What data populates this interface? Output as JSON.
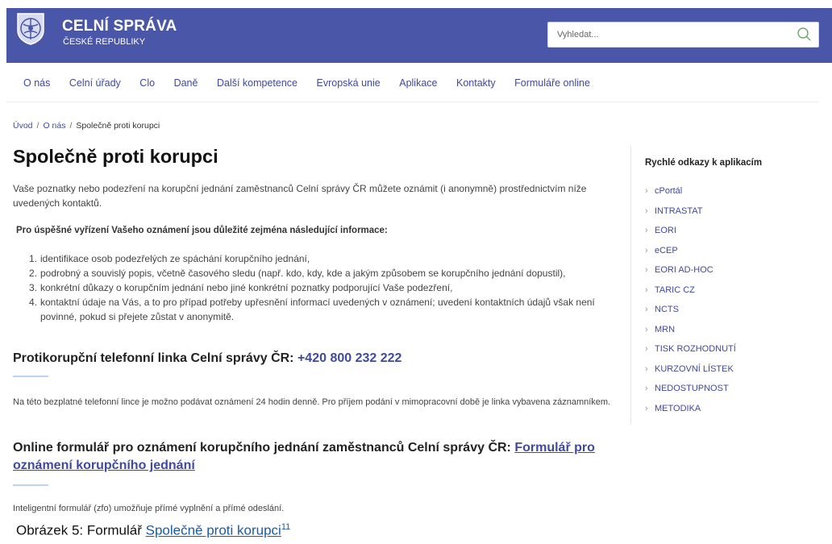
{
  "header": {
    "brand_title": "CELNÍ SPRÁVA",
    "brand_subtitle": "ČESKÉ REPUBLIKY",
    "search_placeholder": "Vyhledat...",
    "background": "#4a56a8"
  },
  "nav": {
    "items": [
      "O nás",
      "Celní úřady",
      "Clo",
      "Daně",
      "Další kompetence",
      "Evropská unie",
      "Aplikace",
      "Kontakty",
      "Formuláře online"
    ]
  },
  "breadcrumb": {
    "items": [
      "Úvod",
      "O nás",
      "Společně proti korupci"
    ],
    "separator": "/"
  },
  "main": {
    "title": "Společně proti korupci",
    "intro": "Vaše poznatky nebo podezření na korupční jednání zaměstnanců Celní správy ČR můžete oznámit (i anonymně) prostřednictvím níže uvedených kontaktů.",
    "bold_note": "Pro úspěšné vyřízení Vašeho oznámení jsou důležité zejména následující informace:",
    "list": [
      "identifikace osob podezřelých ze spáchání korupčního jednání,",
      "podrobný a souvislý popis, včetně časového sledu (např. kdo, kdy, kde a jakým způsobem se korupčního jednání dopustil),",
      "konkrétní důkazy o korupčním jednání nebo jiné konkrétní poznatky podporující Vaše podezření,",
      "kontaktní údaje na Vás, a to pro případ potřeby upřesnění informací uvedených v oznámení; uvedení kontaktních údajů však není povinné, pokud si přejete zůstat v anonymitě."
    ],
    "phone_heading": "Protikorupční telefonní linka Celní správy ČR: ",
    "phone_number": "+420 800 232 222",
    "phone_text": "Na této bezplatné telefonní lince je možno podávat oznámení 24 hodin denně. Pro příjem podání v mimopracovní době je linka vybavena záznamníkem.",
    "online_heading": "Online formulář pro oznámení korupčního jednání zaměstnanců Celní správy ČR: ",
    "online_link": "Formulář pro oznámení korupčního jednání",
    "zfo_text": "Inteligentní formulář (zfo) umožňuje přímé vyplnění a přímé odeslání."
  },
  "sidebar": {
    "title": "Rychlé odkazy k aplikacím",
    "items": [
      "cPortál",
      "INTRASTAT",
      "EORI",
      "eCEP",
      "EORI AD-HOC",
      "TARIC CZ",
      "NCTS",
      "MRN",
      "TISK ROZHODNUTÍ",
      "KURZOVNÍ LÍSTEK",
      "NEDOSTUPNOST",
      "METODIKA"
    ]
  },
  "caption": {
    "prefix": "Obrázek 5: Formulář ",
    "link": "Společně proti korupci",
    "footnote": "11"
  }
}
